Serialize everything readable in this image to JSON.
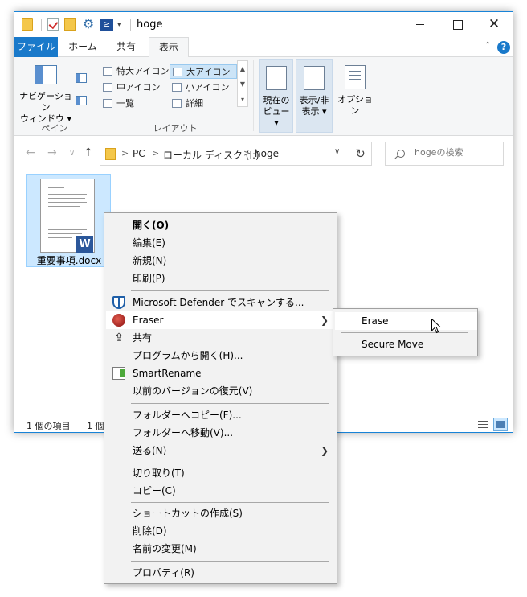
{
  "window": {
    "title": "hoge",
    "controls": {
      "minimize": "",
      "maximize": "",
      "close": "✕"
    },
    "quick_access_ps": "≥",
    "quick_access_more": "▾"
  },
  "ribbon": {
    "tabs": [
      "ファイル",
      "ホーム",
      "共有",
      "表示"
    ],
    "active_tab": "表示",
    "help": "?",
    "collapse_glyph": "⌃",
    "pane_group": {
      "nav_pane_line1": "ナビゲーション",
      "nav_pane_line2": "ウィンドウ ▾",
      "label": "ペイン"
    },
    "layout_group": {
      "items": [
        "特大アイコン",
        "大アイコン",
        "中アイコン",
        "小アイコン",
        "一覧",
        "詳細"
      ],
      "selected": "大アイコン",
      "scroll_glyphs": [
        "▲",
        "▼",
        "▾"
      ],
      "label": "レイアウト"
    },
    "current_view": {
      "line1": "現在の",
      "line2": "ビュー ▾"
    },
    "show_hide": {
      "line1": "表示/非",
      "line2": "表示 ▾"
    },
    "options": "オプション"
  },
  "address_bar": {
    "back": "←",
    "forward": "→",
    "recent": "∨",
    "up": "↑",
    "path": [
      "PC",
      "ローカル ディスク (I:)",
      "hoge"
    ],
    "separator": ">",
    "dropdown": "∨",
    "refresh": "↻",
    "search_placeholder": "hogeの検索"
  },
  "content": {
    "file_name": "重要事項.docx",
    "word_badge": "W"
  },
  "status": {
    "item_count": "1 個の項目",
    "selected_prefix": "1 個"
  },
  "context_menu": {
    "group1": [
      "開く(O)",
      "編集(E)",
      "新規(N)",
      "印刷(P)"
    ],
    "defender": "Microsoft Defender でスキャンする...",
    "eraser": "Eraser",
    "share": "共有",
    "open_with": "プログラムから開く(H)...",
    "smartrename": "SmartRename",
    "restore": "以前のバージョンの復元(V)",
    "copy_to": "フォルダーへコピー(F)...",
    "move_to": "フォルダーへ移動(V)...",
    "send_to": "送る(N)",
    "cut": "切り取り(T)",
    "copy": "コピー(C)",
    "shortcut": "ショートカットの作成(S)",
    "delete": "削除(D)",
    "rename": "名前の変更(M)",
    "properties": "プロパティ(R)",
    "arrow": "❯",
    "share_glyph": "⇪"
  },
  "submenu": {
    "erase": "Erase",
    "secure_move": "Secure Move"
  }
}
